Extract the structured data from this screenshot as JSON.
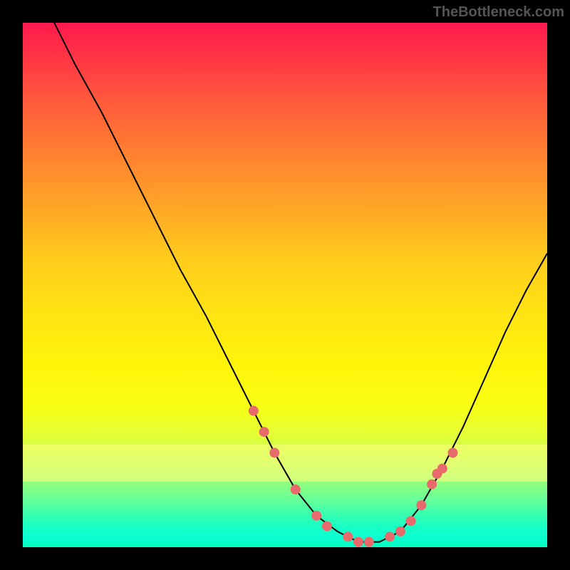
{
  "watermark": "TheBottleneck.com",
  "chart_data": {
    "type": "line",
    "title": "",
    "xlabel": "",
    "ylabel": "",
    "xlim": [
      0,
      100
    ],
    "ylim": [
      0,
      100
    ],
    "series": [
      {
        "name": "curve",
        "x": [
          6,
          10,
          15,
          20,
          25,
          30,
          35,
          40,
          44,
          48,
          52,
          56,
          60,
          64,
          68,
          72,
          76,
          80,
          84,
          88,
          92,
          96,
          100
        ],
        "values": [
          100,
          92,
          83,
          73,
          63,
          53,
          44,
          34,
          26,
          18,
          11,
          6,
          3,
          1,
          1,
          3,
          8,
          15,
          23,
          32,
          41,
          49,
          56
        ]
      }
    ],
    "markers": {
      "name": "highlighted-points",
      "x": [
        44,
        46,
        48,
        52,
        56,
        58,
        62,
        64,
        66,
        70,
        72,
        74,
        76,
        78,
        79,
        80,
        82
      ],
      "values": [
        26,
        22,
        18,
        11,
        6,
        4,
        2,
        1,
        1,
        2,
        3,
        5,
        8,
        12,
        14,
        15,
        18
      ]
    },
    "background_gradient": {
      "top": "#ff1a4d",
      "mid": "#fff40a",
      "bottom": "#00ffc0"
    }
  }
}
